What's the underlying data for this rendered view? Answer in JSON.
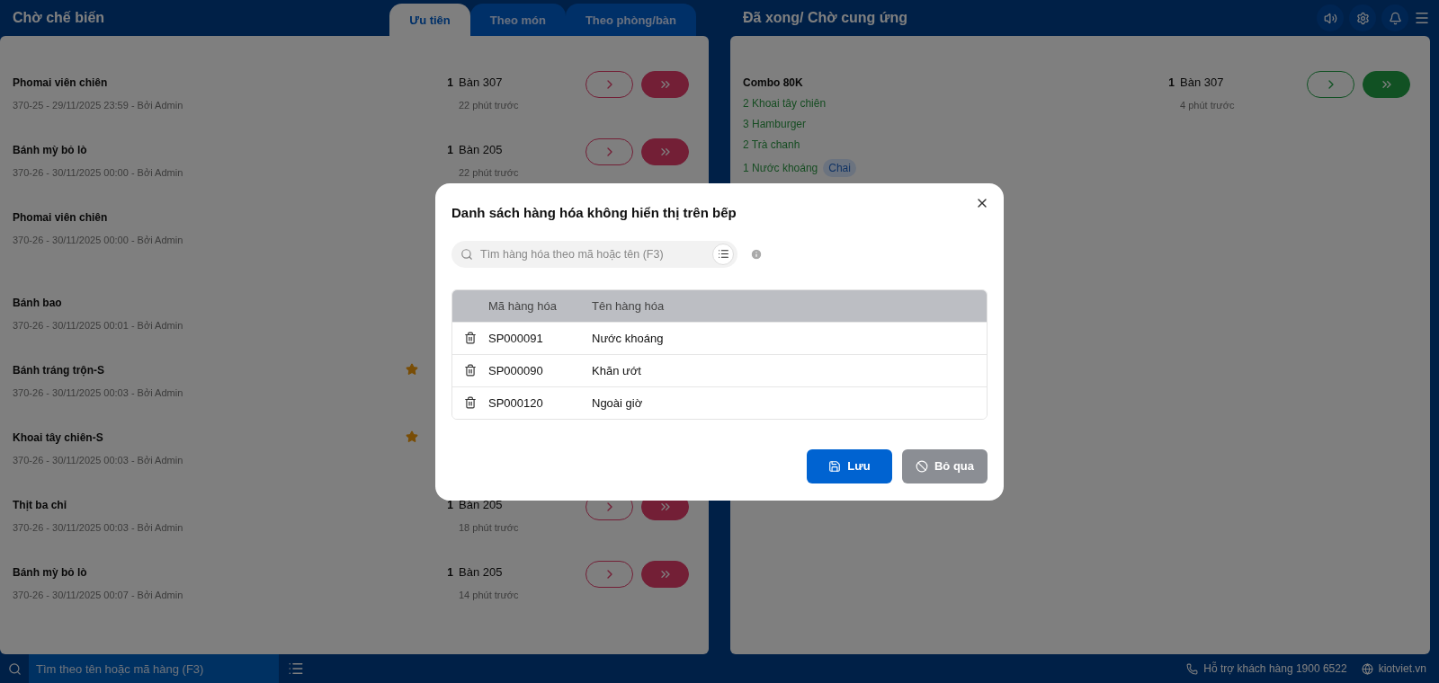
{
  "left_panel": {
    "title": "Chờ chế biến",
    "tabs": [
      {
        "label": "Ưu tiên",
        "selected": true
      },
      {
        "label": "Theo món",
        "selected": false
      },
      {
        "label": "Theo phòng/bàn",
        "selected": false
      }
    ],
    "orders": [
      {
        "name": "Phomai viên chiên",
        "meta": "370-25 - 29/11/2025 23:59 - Bởi Admin",
        "starred": false,
        "quantity": "1",
        "table": "Bàn 307",
        "elapsed": "22 phút trước"
      },
      {
        "name": "Bánh mỳ bỏ lò",
        "meta": "370-26 - 30/11/2025 00:00 - Bởi Admin",
        "starred": false,
        "quantity": "1",
        "table": "Bàn 205",
        "elapsed": "22 phút trước"
      },
      {
        "name": "Phomai viên chiên",
        "meta": "370-26 - 30/11/2025 00:00 - Bởi Admin",
        "starred": false,
        "tall": true
      },
      {
        "name": "Bánh bao",
        "meta": "370-26 - 30/11/2025 00:01 - Bởi Admin",
        "starred": false
      },
      {
        "name": "Bánh tráng trộn-S",
        "meta": "370-26 - 30/11/2025 00:03 - Bởi Admin",
        "starred": true
      },
      {
        "name": "Khoai tây chiên-S",
        "meta": "370-26 - 30/11/2025 00:03 - Bởi Admin",
        "starred": true
      },
      {
        "name": "Thịt ba chỉ",
        "meta": "370-26 - 30/11/2025 00:03 - Bởi Admin",
        "starred": false,
        "quantity": "1",
        "table": "Bàn 205",
        "elapsed": "18 phút trước"
      },
      {
        "name": "Bánh mỳ bỏ lò",
        "meta": "370-26 - 30/11/2025 00:07 - Bởi Admin",
        "starred": false,
        "quantity": "1",
        "table": "Bàn 205",
        "elapsed": "14 phút trước"
      }
    ]
  },
  "right_panel": {
    "title": "Đã xong/ Chờ cung ứng",
    "orders": [
      {
        "name": "Combo 80K",
        "items": [
          {
            "text": "2 Khoai tây chiên"
          },
          {
            "text": "3 Hamburger"
          },
          {
            "text": "2 Trà chanh"
          },
          {
            "text": "1 Nước khoáng",
            "tag": "Chai"
          }
        ],
        "quantity": "1",
        "table": "Bàn 307",
        "elapsed": "4 phút trước"
      }
    ]
  },
  "bottom_bar": {
    "search_placeholder": "Tìm theo tên hoặc mã hàng (F3)",
    "support": "Hỗ trợ khách hàng 1900 6522",
    "website": "kiotviet.vn"
  },
  "dialog": {
    "title": "Danh sách hàng hóa không hiển thị trên bếp",
    "search_placeholder": "Tìm hàng hóa theo mã hoặc tên (F3)",
    "columns": [
      "Mã hàng hóa",
      "Tên hàng hóa"
    ],
    "rows": [
      {
        "code": "SP000091",
        "name": "Nước khoáng"
      },
      {
        "code": "SP000090",
        "name": "Khăn ướt"
      },
      {
        "code": "SP000120",
        "name": "Ngoài giờ"
      }
    ],
    "buttons": [
      {
        "kind": "save",
        "label": "Lưu"
      },
      {
        "kind": "cancel",
        "label": "Bỏ qua"
      }
    ]
  }
}
